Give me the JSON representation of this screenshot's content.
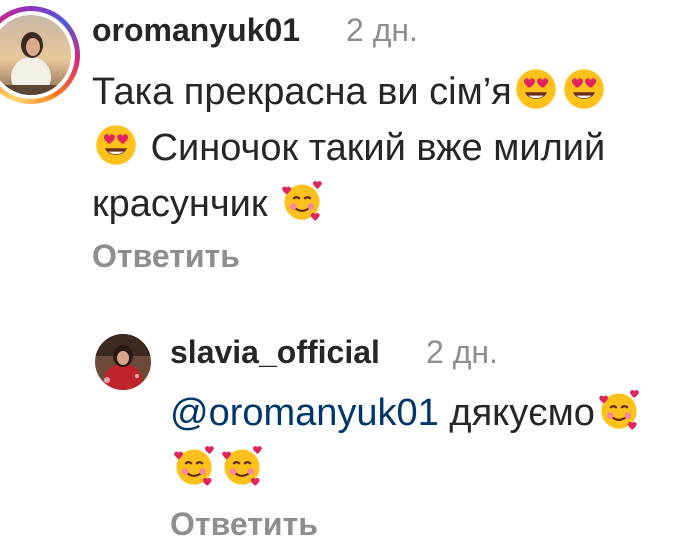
{
  "comments": [
    {
      "username": "oromanyuk01",
      "time": "2 дн.",
      "line1": "Така прекрасна ви сім’я",
      "line2": "Синочок такий вже милий",
      "line3": "красунчик",
      "reply_label": "Ответить",
      "emoji": [
        "heart-eyes-emoji",
        "heart-eyes-emoji",
        "heart-eyes-emoji",
        "smiling-face-with-hearts-emoji"
      ]
    },
    {
      "username": "slavia_official",
      "time": "2 дн.",
      "mention": "@oromanyuk01",
      "text": "дякуємо",
      "reply_label": "Ответить",
      "emoji": [
        "smiling-face-with-hearts-emoji",
        "smiling-face-with-hearts-emoji",
        "smiling-face-with-hearts-emoji"
      ]
    }
  ],
  "colors": {
    "text": "#262626",
    "secondary": "#8e8e8e",
    "mention": "#00376b",
    "story_ring": [
      "#feda75",
      "#fa7e1e",
      "#d62976",
      "#962fbf",
      "#4f5bd5"
    ]
  }
}
